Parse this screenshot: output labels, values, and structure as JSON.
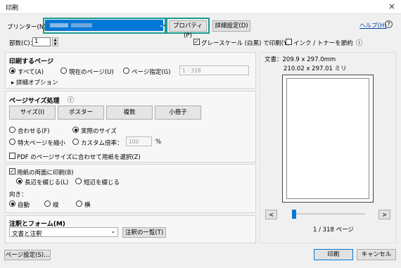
{
  "window": {
    "title": "印刷",
    "close_glyph": "×"
  },
  "printer": {
    "label": "プリンター(N)：",
    "selected": "",
    "properties_button": "プロパティ(P)",
    "advanced_button": "詳細設定(D)",
    "help_link": "ヘルプ(H)",
    "help_icon": "?"
  },
  "copies": {
    "label": "部数(C)：",
    "value": "1",
    "grayscale_label": "グレースケール (白黒) で印刷(Y)",
    "grayscale_checked": true,
    "ink_save_label": "インク / トナーを節約",
    "ink_save_checked": false,
    "info_icon": "ⓘ"
  },
  "pages": {
    "heading": "印刷するページ",
    "options": [
      "すべて(A)",
      "現在のページ(U)",
      "ページ指定(G)"
    ],
    "selected_index": 0,
    "range_placeholder": "1 - 318",
    "more_options": "▸ 詳細オプション"
  },
  "sizing": {
    "heading": "ページサイズ処理",
    "info_icon": "ⓘ",
    "buttons": [
      "サイズ(I)",
      "ポスター",
      "複数",
      "小冊子"
    ],
    "radio_row1": [
      "合わせる(F)",
      "実際のサイズ"
    ],
    "radio_row2": [
      "特大ページを縮小",
      "カスタム倍率："
    ],
    "selected": "実際のサイズ",
    "scale_value": "100",
    "percent": "%",
    "pdf_paper_label": "PDF のページサイズに合わせて用紙を選択(Z)",
    "pdf_paper_checked": false
  },
  "duplex": {
    "label": "用紙の両面に印刷(B)",
    "checked": true,
    "options": [
      "長辺を綴じる(L)",
      "短辺を綴じる"
    ],
    "selected_index": 0
  },
  "orientation": {
    "label": "向き：",
    "options": [
      "自動",
      "縦",
      "横"
    ],
    "selected_index": 0
  },
  "comments": {
    "heading": "注釈とフォーム(M)",
    "selected": "文書と注釈",
    "summary_button": "注釈の一覧(T)"
  },
  "preview": {
    "doc_size": "文書：209.9 x 297.0mm",
    "paper_size": "210.02 x 297.01 ミリ",
    "prev": "<",
    "next": ">",
    "page_status": "1 / 318 ページ",
    "page_current": 1,
    "page_total": 318
  },
  "footer": {
    "page_setup": "ページ設定(S)...",
    "print": "印刷",
    "cancel": "キャンセル"
  },
  "colors": {
    "highlight": "#1a9c8f",
    "selection": "#0078d7",
    "link": "#0645ad"
  }
}
